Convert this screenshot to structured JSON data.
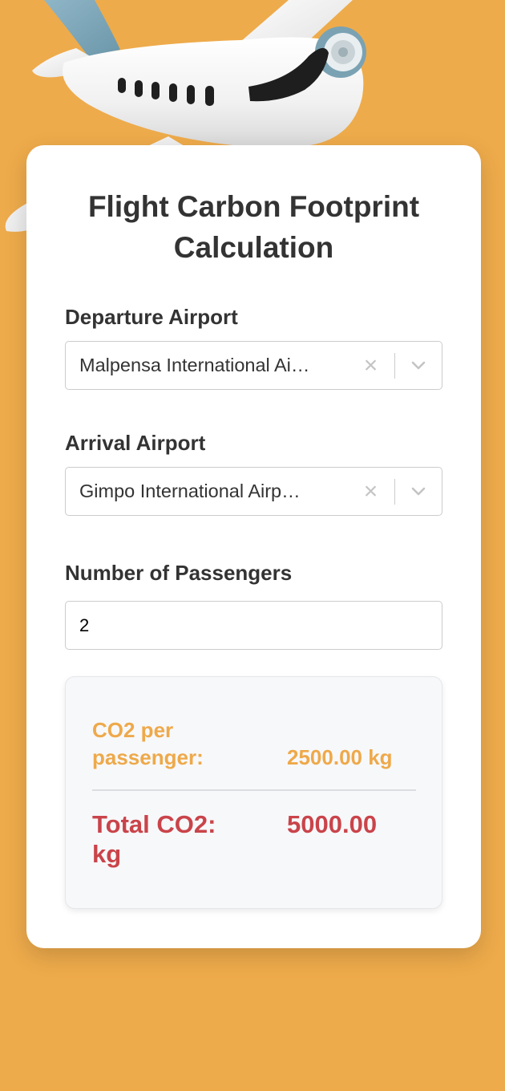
{
  "colors": {
    "background": "#eeab4b",
    "card": "#ffffff",
    "heading": "#333333",
    "accent_orange": "#eea94a",
    "accent_red": "#c9444a"
  },
  "header_image": {
    "icon": "airplane-illustration"
  },
  "form": {
    "title": "Flight Carbon Footprint Calculation",
    "departure": {
      "label": "Departure Airport",
      "value": "Malpensa International Ai…",
      "clear_icon": "×",
      "dropdown_icon": "chevron-down"
    },
    "arrival": {
      "label": "Arrival Airport",
      "value": "Gimpo International Airp…",
      "clear_icon": "×",
      "dropdown_icon": "chevron-down"
    },
    "passengers": {
      "label": "Number of Passengers",
      "value": "2"
    }
  },
  "results": {
    "per_passenger_label": "CO2 per\npassenger:",
    "per_passenger_value": "2500.00 kg",
    "total_label": "Total CO2:\nkg",
    "total_value": "5000.00"
  }
}
